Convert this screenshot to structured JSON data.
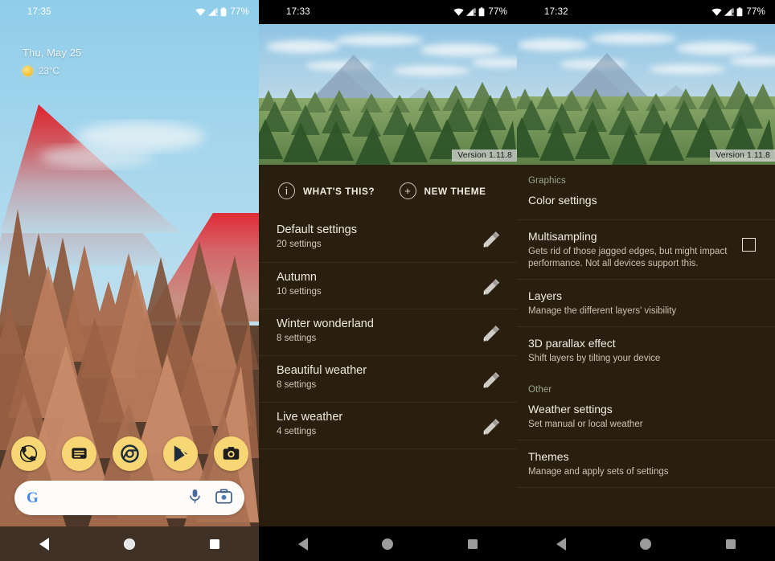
{
  "home": {
    "status": {
      "time": "17:35",
      "battery": "77%",
      "wifi_icon": "wifi-icon",
      "signal_icon": "cell-signal-icon",
      "battery_icon": "battery-icon"
    },
    "widget": {
      "date": "Thu, May 25",
      "temperature": "23°C",
      "weather_icon": "sun-icon"
    },
    "dock": [
      {
        "name": "phone-icon",
        "label": "Phone"
      },
      {
        "name": "messages-icon",
        "label": "Messages"
      },
      {
        "name": "chrome-icon",
        "label": "Chrome"
      },
      {
        "name": "play-store-icon",
        "label": "Play Store"
      },
      {
        "name": "camera-icon",
        "label": "Camera"
      }
    ],
    "search": {
      "logo": "google-g-logo",
      "mic_icon": "microphone-icon",
      "lens_icon": "google-lens-icon",
      "placeholder": ""
    },
    "nav": {
      "back": "back-icon",
      "home": "home-icon",
      "recents": "recents-icon"
    }
  },
  "themes": {
    "status": {
      "time": "17:33",
      "battery": "77%"
    },
    "hero": {
      "version": "Version 1.11.8"
    },
    "actions": [
      {
        "icon": "info-icon",
        "glyph": "i",
        "label": "WHAT'S THIS?"
      },
      {
        "icon": "plus-icon",
        "glyph": "+",
        "label": "NEW THEME"
      }
    ],
    "items": [
      {
        "title": "Default settings",
        "subtitle": "20 settings",
        "edit_icon": "pencil-icon"
      },
      {
        "title": "Autumn",
        "subtitle": "10 settings",
        "edit_icon": "pencil-icon"
      },
      {
        "title": "Winter wonderland",
        "subtitle": "8 settings",
        "edit_icon": "pencil-icon"
      },
      {
        "title": "Beautiful weather",
        "subtitle": "8 settings",
        "edit_icon": "pencil-icon"
      },
      {
        "title": "Live weather",
        "subtitle": "4 settings",
        "edit_icon": "pencil-icon"
      }
    ]
  },
  "settings": {
    "status": {
      "time": "17:32",
      "battery": "77%"
    },
    "hero": {
      "version": "Version 1.11.8"
    },
    "sections": [
      {
        "header": "Graphics"
      },
      {
        "header": "Other"
      }
    ],
    "graphics_header": "Graphics",
    "other_header": "Other",
    "items": [
      {
        "title": "Color settings",
        "subtitle": "",
        "checkbox": false
      },
      {
        "title": "Multisampling",
        "subtitle": "Gets rid of those jagged edges, but might impact performance. Not all devices support this.",
        "checkbox": true,
        "checked": false
      },
      {
        "title": "Layers",
        "subtitle": "Manage the different layers' visibility",
        "checkbox": false
      },
      {
        "title": "3D parallax effect",
        "subtitle": "Shift layers by tilting your device",
        "checkbox": false
      }
    ],
    "other_items": [
      {
        "title": "Weather settings",
        "subtitle": "Set manual or local weather"
      },
      {
        "title": "Themes",
        "subtitle": "Manage and apply sets of settings"
      }
    ]
  },
  "colors": {
    "panel_bg": "#2a1e0e",
    "divider": "#3a2c18",
    "accent_dock": "#f7d773",
    "section_header": "#9aa88c",
    "title_text": "#f2eee7",
    "sub_text": "#cbc3b4",
    "navbar_home": "#3f3126"
  }
}
